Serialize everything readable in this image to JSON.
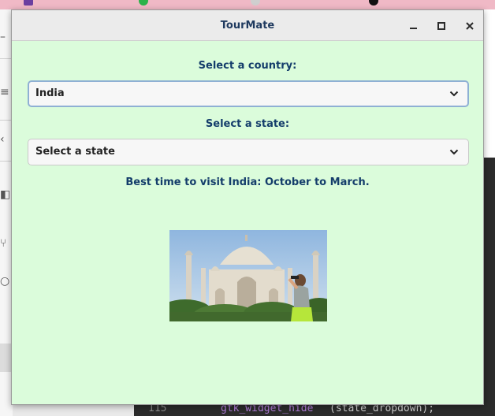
{
  "window": {
    "title": "TourMate"
  },
  "form": {
    "country_label": "Select a country:",
    "country_value": "India",
    "state_label": "Select a state:",
    "state_value": "Select a state",
    "info_text": "Best time to visit India: October to March."
  },
  "background": {
    "editor_line_number": "115",
    "editor_code_func": "gtk_widget_hide",
    "editor_code_args": "(state_dropdown);"
  },
  "icons": {
    "minimize": "minimize-icon",
    "maximize": "maximize-icon",
    "close": "close-icon",
    "dropdown": "chevron-down-icon"
  },
  "colors": {
    "window_background": "#dbfcdb",
    "label_text": "#143d6b",
    "focus_border": "#8fb0d4"
  }
}
